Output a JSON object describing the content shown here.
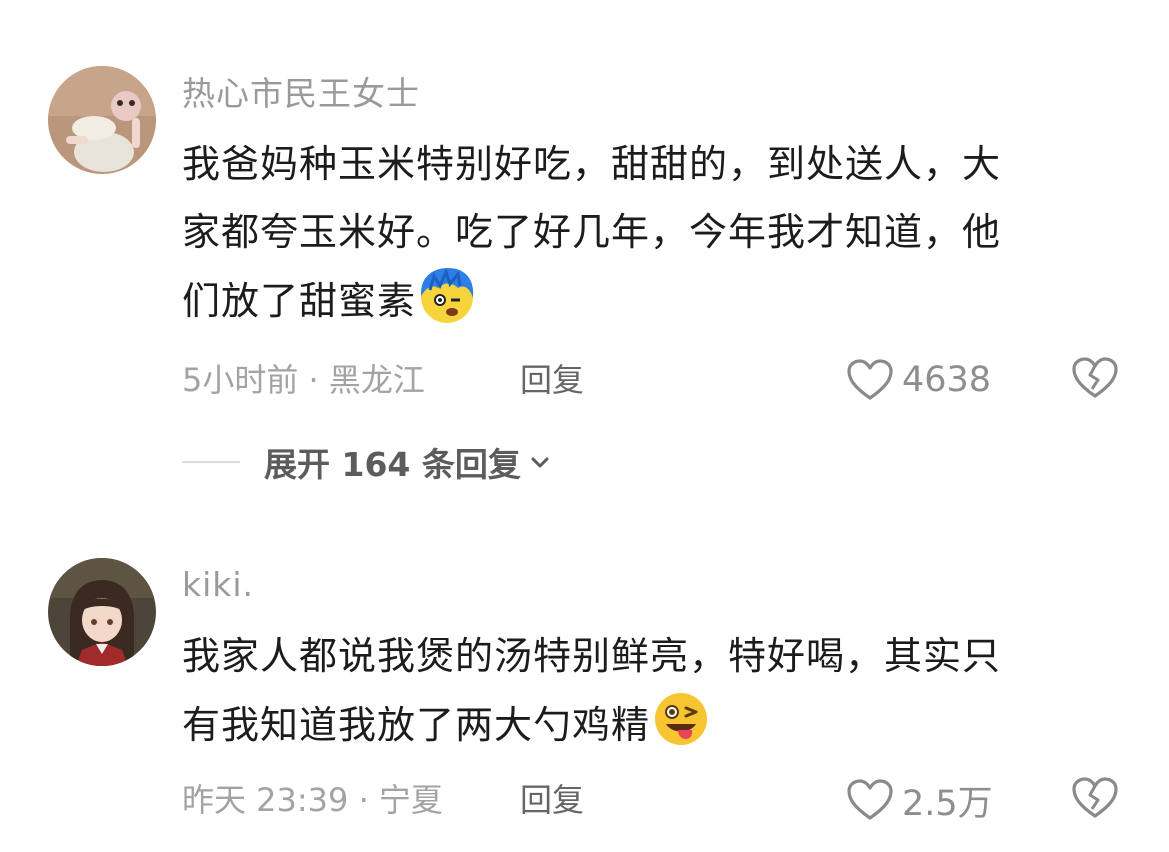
{
  "comments": [
    {
      "username": "热心市民王女士",
      "lines": [
        "我爸妈种玉米特别好吃，甜甜的，到处送人，大",
        "家都夸玉米好。吃了好几年，今年我才知道，他",
        "们放了甜蜜素"
      ],
      "emoji": "shocked-blue-hair-emoji",
      "meta": "5小时前 · 黑龙江",
      "reply_label": "回复",
      "like_count": "4638",
      "expand_label": "展开 164 条回复"
    },
    {
      "username": "kiki.",
      "lines": [
        "我家人都说我煲的汤特别鲜亮，特好喝，其实只",
        "有我知道我放了两大勺鸡精"
      ],
      "emoji": "winking-tongue-emoji",
      "meta": "昨天 23:39 · 宁夏",
      "reply_label": "回复",
      "like_count": "2.5万"
    }
  ],
  "icons": {
    "like": "heart-outline-icon",
    "dislike": "broken-heart-icon",
    "expand": "chevron-down-icon"
  },
  "colors": {
    "username": "#9a9a9a",
    "meta": "#a3a3a3",
    "body": "#1c1c1c",
    "icon": "#8a8a8a"
  }
}
